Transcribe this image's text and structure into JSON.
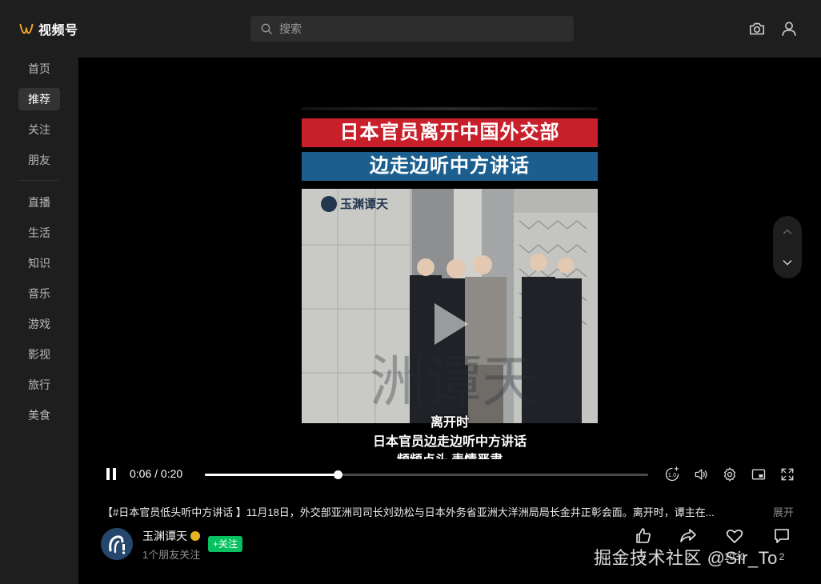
{
  "app": {
    "name": "视频号"
  },
  "search": {
    "placeholder": "搜索"
  },
  "sidebar": {
    "items": [
      {
        "label": "首页"
      },
      {
        "label": "推荐"
      },
      {
        "label": "关注"
      },
      {
        "label": "朋友"
      },
      {
        "label": "直播"
      },
      {
        "label": "生活"
      },
      {
        "label": "知识"
      },
      {
        "label": "音乐"
      },
      {
        "label": "游戏"
      },
      {
        "label": "影视"
      },
      {
        "label": "旅行"
      },
      {
        "label": "美食"
      }
    ],
    "active_index": 1
  },
  "video": {
    "headline_1": "日本官员离开中国外交部",
    "headline_2": "边走边听中方讲话",
    "channel_watermark": "玉渊谭天",
    "subtitle_1": "离开时",
    "subtitle_2": "日本官员边走边听中方讲话",
    "subtitle_3": "频频点头 表情严肃",
    "time_display": "0:06 / 0:20",
    "progress": 0.3,
    "speed_label": "1.0",
    "description": "【#日本官员低头听中方讲话 】11月18日，外交部亚洲司司长刘劲松与日本外务省亚洲大洋洲局局长金井正彰会面。离开时，谭主在...",
    "expand_label": "展开"
  },
  "author": {
    "name": "玉渊谭天",
    "friends_following": "1个朋友关注",
    "follow_label": "+关注"
  },
  "actions": {
    "like_count": "2",
    "share_count": "2",
    "favorite_count": "1030",
    "comment_count": "2"
  },
  "watermark": {
    "text": "掘金技术社区 @Sir_To"
  },
  "colors": {
    "accent_orange": "#f5a623",
    "follow_green": "#07c160",
    "headline_red": "#c8202a",
    "headline_blue": "#1c5f8f"
  }
}
